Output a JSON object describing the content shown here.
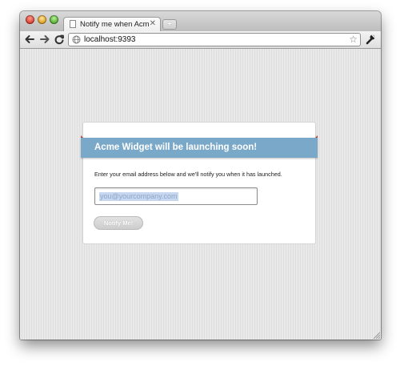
{
  "browser": {
    "tab": {
      "title": "Notify me when Acme Widge",
      "close_glyph": "✕"
    },
    "new_tab_glyph": "+",
    "address_bar": {
      "url": "localhost:9393",
      "security_icon": "globe-icon"
    },
    "toolbar_icons": [
      "back-arrow-icon",
      "forward-arrow-icon",
      "reload-icon",
      "star-icon",
      "wrench-icon"
    ],
    "star_glyph": "☆"
  },
  "page": {
    "banner_title": "Acme Widget will be launching soon!",
    "lead_text": "Enter your email address below and we'll notify you when it has launched.",
    "email_placeholder": "you@yourcompany.com",
    "notify_button_label": "Notify Me!"
  },
  "colors": {
    "banner": "#79a8c9",
    "banner_text": "#ffffff",
    "button": "#d4d4d4",
    "page_background": "#e6e6e6"
  }
}
